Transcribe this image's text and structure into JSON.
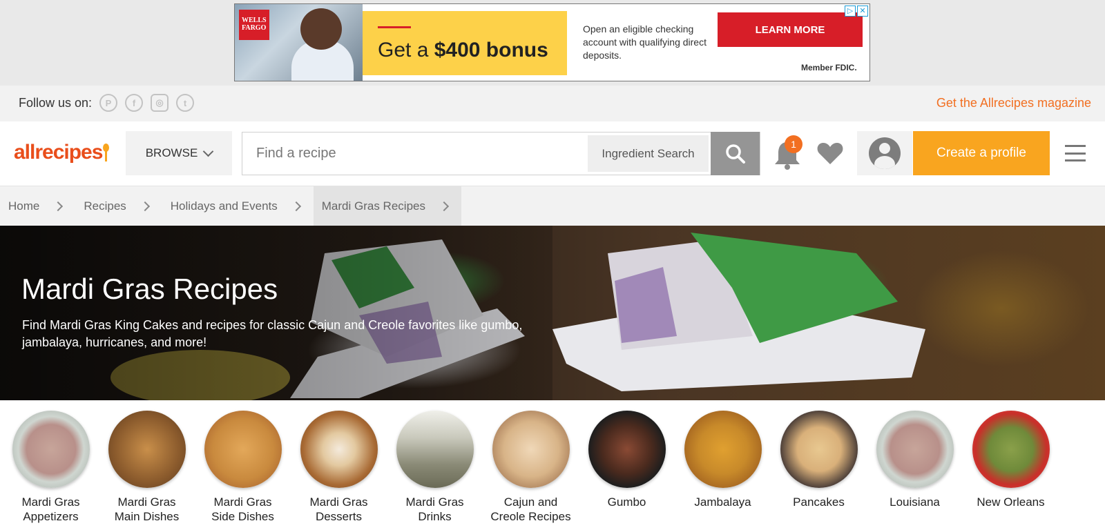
{
  "ad": {
    "logo_text": "WELLS FARGO",
    "headline_prefix": "Get a ",
    "headline_amount": "$400 bonus",
    "copy": "Open an eligible checking account with qualifying direct deposits.",
    "cta": "LEARN MORE",
    "fdic": "Member FDIC.",
    "colors": {
      "brand": "#d71e28",
      "highlight": "#fdd149"
    }
  },
  "social": {
    "follow_label": "Follow us on:",
    "icons": [
      "pinterest-icon",
      "facebook-icon",
      "instagram-icon",
      "twitter-icon"
    ],
    "magazine_link": "Get the Allrecipes magazine"
  },
  "header": {
    "logo": "allrecipes",
    "browse_label": "BROWSE",
    "search_placeholder": "Find a recipe",
    "ingredient_search_label": "Ingredient Search",
    "notification_count": "1",
    "create_profile_label": "Create a profile",
    "colors": {
      "logo": "#e94e1b",
      "accent": "#f26f21",
      "cta": "#f9a51f"
    }
  },
  "breadcrumb": {
    "items": [
      {
        "label": "Home"
      },
      {
        "label": "Recipes"
      },
      {
        "label": "Holidays and Events"
      },
      {
        "label": "Mardi Gras Recipes"
      }
    ]
  },
  "hero": {
    "title": "Mardi Gras Recipes",
    "description": "Find Mardi Gras King Cakes and recipes for classic Cajun and Creole favorites like gumbo, jambalaya, hurricanes, and more!"
  },
  "categories": {
    "items": [
      {
        "line1": "Mardi Gras",
        "line2": "Appetizers",
        "color": "#c9b8a8"
      },
      {
        "line1": "Mardi Gras",
        "line2": "Main Dishes",
        "color": "#8a5a2c"
      },
      {
        "line1": "Mardi Gras",
        "line2": "Side Dishes",
        "color": "#c98a3e"
      },
      {
        "line1": "Mardi Gras",
        "line2": "Desserts",
        "color": "#a86a34"
      },
      {
        "line1": "Mardi Gras",
        "line2": "Drinks",
        "color": "#9a9a86"
      },
      {
        "line1": "Cajun and",
        "line2": "Creole Recipes",
        "color": "#d8b488"
      },
      {
        "line1": "Gumbo",
        "line2": "",
        "color": "#4a2a1e"
      },
      {
        "line1": "Jambalaya",
        "line2": "",
        "color": "#c88a2a"
      },
      {
        "line1": "Pancakes",
        "line2": "",
        "color": "#d9b07a"
      },
      {
        "line1": "Louisiana",
        "line2": "",
        "color": "#c9b8a8"
      },
      {
        "line1": "New Orleans",
        "line2": "",
        "color": "#6f8a3a"
      }
    ]
  }
}
